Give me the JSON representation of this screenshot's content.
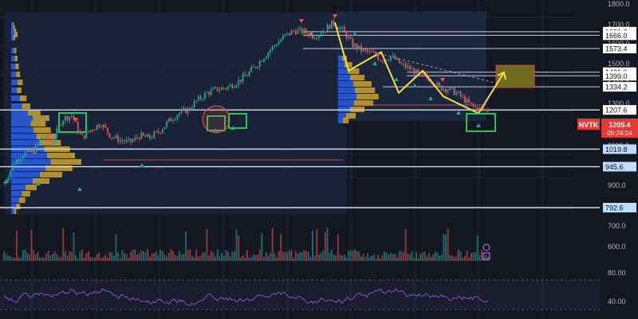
{
  "ticker": {
    "symbol": "NVTK",
    "price": "1205.4",
    "countdown": "09:24:24"
  },
  "price_axis": {
    "ticks": [
      "1800.0",
      "1700.0",
      "1600.0",
      "1500.0",
      "1400.0",
      "1300.0",
      "1100.0",
      "900.0",
      "700.0",
      "600.0"
    ]
  },
  "level_labels": [
    "1691.8",
    "1666.0",
    "1573.4",
    "1421.0",
    "1399.0",
    "1334.2",
    "1207.6",
    "1019.8",
    "945.6",
    "792.6"
  ],
  "rsi_axis": {
    "ticks": [
      "80.00",
      "40.00"
    ]
  },
  "colors": {
    "background": "#131722",
    "grid": "#1f2533",
    "bull": "#26a69a",
    "bear": "#ef5350",
    "profile_blue": "#2a5bd7",
    "profile_gold": "#c8a336",
    "pattern_yellow": "#f2e23a",
    "highlight_green": "#22c55e",
    "rsi": "#7e57c2",
    "ticker_badge": "#e53935"
  },
  "chart_data": {
    "type": "line",
    "series": [
      {
        "values": [
          880,
          960,
          1000,
          1010,
          1080,
          1050,
          1160,
          1180,
          1070,
          1110,
          1140,
          1080,
          1060,
          1050,
          1080,
          1070,
          1100,
          1150,
          1190,
          1210,
          1260,
          1300,
          1320,
          1330,
          1360,
          1400,
          1460,
          1530,
          1600,
          1660,
          1700,
          1690,
          1660,
          1700,
          1760,
          1700,
          1600,
          1560,
          1540,
          1500,
          1520,
          1470,
          1440,
          1400,
          1380,
          1330,
          1320,
          1290,
          1240,
          1210,
          1205.4
        ]
      }
    ],
    "yscale": "log",
    "ylim": [
      760,
      1830
    ],
    "levels": [
      1691.8,
      1666.0,
      1573.4,
      1421.0,
      1399.0,
      1334.2,
      1207.6,
      1019.8,
      945.6,
      792.6
    ],
    "projection_path": [
      1760,
      1430,
      1550,
      1300,
      1430,
      1280,
      1190,
      1420
    ],
    "rsi": {
      "ticks": [
        80,
        40
      ]
    }
  }
}
